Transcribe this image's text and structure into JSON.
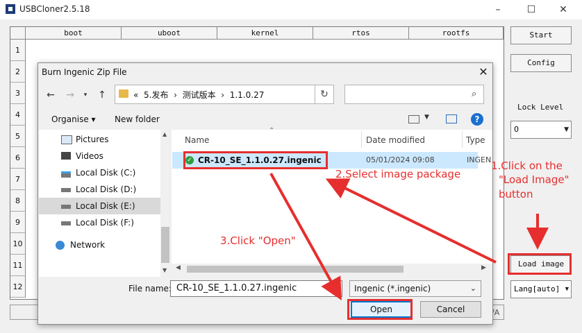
{
  "app": {
    "title": "USBCloner2.5.18",
    "minimize": "–",
    "maximize": "☐",
    "close": "✕"
  },
  "grid": {
    "columns": [
      "boot",
      "uboot",
      "kernel",
      "rtos",
      "rootfs"
    ],
    "rows": [
      "1",
      "2",
      "3",
      "4",
      "5",
      "6",
      "7",
      "8",
      "9",
      "10",
      "11",
      "12"
    ]
  },
  "right_panel": {
    "start_label": "Start",
    "config_label": "Config",
    "lock_level_label": "Lock Level",
    "lock_level_value": "0",
    "load_image_label": "Load image",
    "lang_value": "Lang[auto]"
  },
  "status": {
    "text": "/A"
  },
  "dialog": {
    "title": "Burn Ingenic Zip File",
    "close": "✕",
    "address": {
      "prefix": "«",
      "segments": [
        "5.发布",
        "测试版本",
        "1.1.0.27"
      ],
      "separator": "›"
    },
    "search_icon": "⌕",
    "refresh_icon": "↻",
    "toolbar": {
      "organise_label": "Organise ▾",
      "new_folder_label": "New folder",
      "help_label": "?"
    },
    "nav_items": [
      {
        "label": "Pictures",
        "icon": "pictures-icon"
      },
      {
        "label": "Videos",
        "icon": "videos-icon"
      },
      {
        "label": "Local Disk (C:)",
        "icon": "drive-icon"
      },
      {
        "label": "Local Disk (D:)",
        "icon": "drive-icon"
      },
      {
        "label": "Local Disk (E:)",
        "icon": "drive-icon"
      },
      {
        "label": "Local Disk (F:)",
        "icon": "drive-icon"
      },
      {
        "label": "Network",
        "icon": "network-icon"
      }
    ],
    "headers": {
      "name": "Name",
      "date": "Date modified",
      "type": "Type"
    },
    "file": {
      "name": "CR-10_SE_1.1.0.27.ingenic",
      "date": "05/01/2024 09:08",
      "type": "INGEN"
    },
    "file_name_label": "File name:",
    "file_name_value": "CR-10_SE_1.1.0.27.ingenic",
    "file_type_value": "Ingenic (*.ingenic)",
    "open_label": "Open",
    "cancel_label": "Cancel"
  },
  "annotations": {
    "step1_line1": "1.Click on the",
    "step1_line2": "\"Load Image\"",
    "step1_line3": "button",
    "step2": "2.Select image package",
    "step3": "3.Click \"Open\""
  },
  "colors": {
    "annotation_red": "#e62e2e",
    "accent_blue": "#0078d4",
    "selection_blue": "#cce8ff"
  }
}
